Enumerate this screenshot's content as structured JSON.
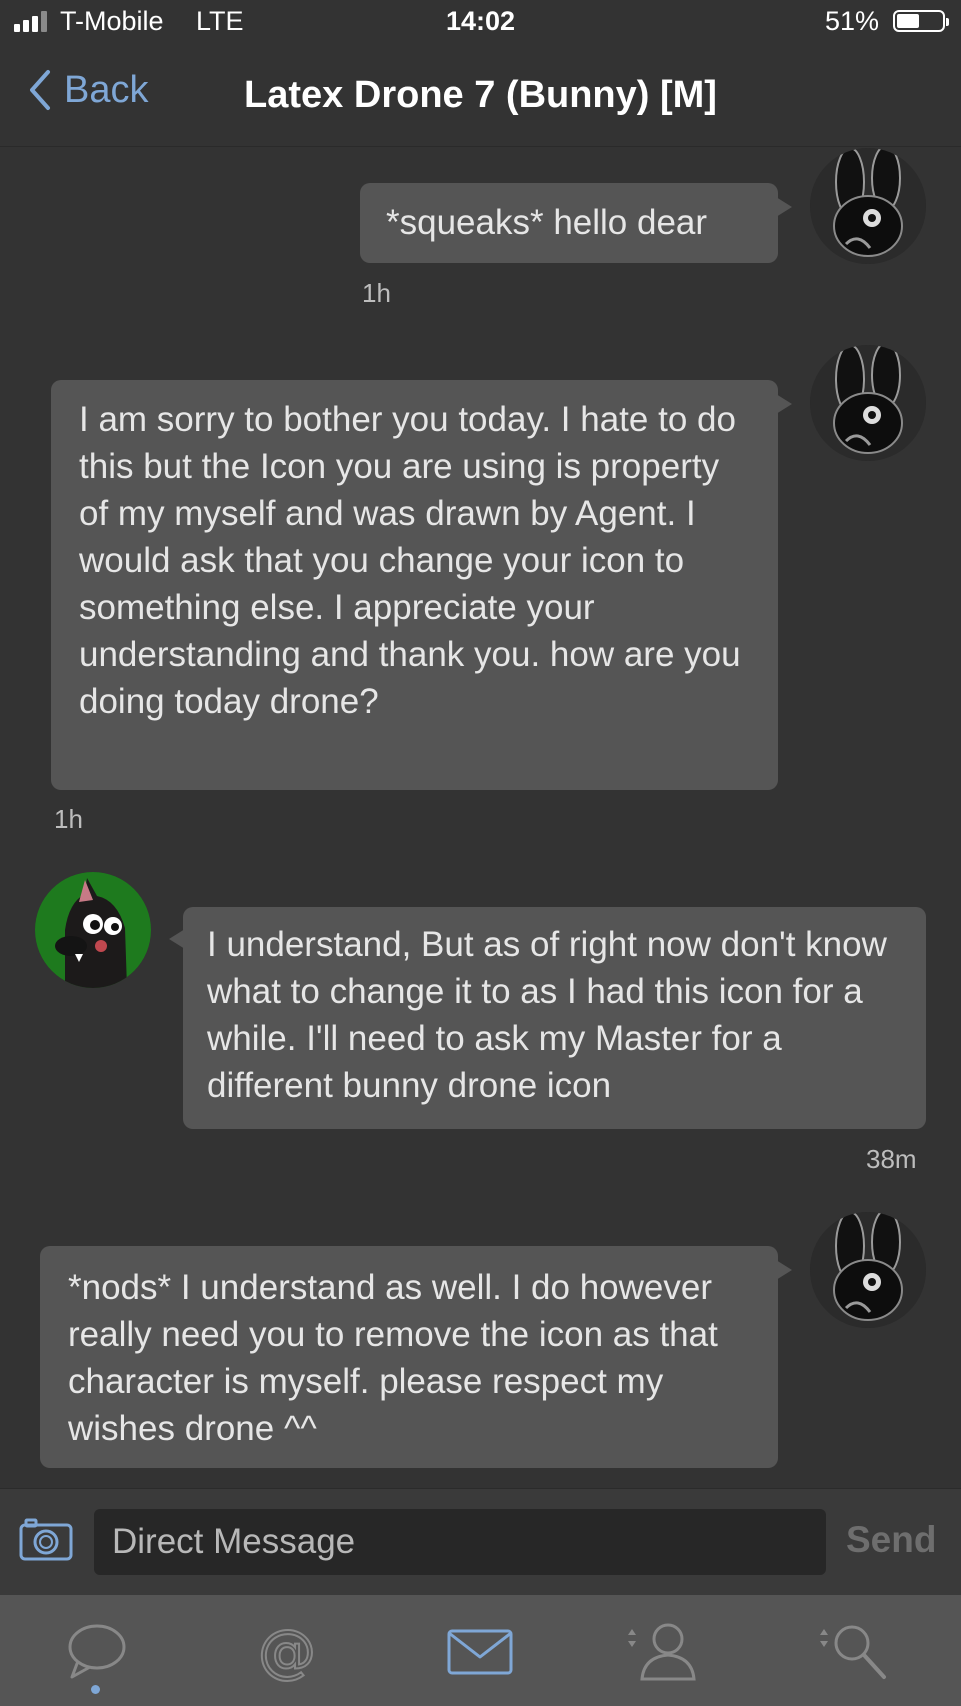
{
  "status_bar": {
    "carrier": "T-Mobile",
    "network": "LTE",
    "time": "14:02",
    "battery_percent_text": "51%",
    "battery_level": 0.51,
    "signal_bars_active": 3,
    "signal_bars_total": 4
  },
  "nav": {
    "back_label": "Back",
    "title": "Latex Drone 7 (Bunny) [M]"
  },
  "messages": [
    {
      "sender": "Latex Drone 7 (Bunny) [M]",
      "avatar": "bunny-drone-avatar",
      "text": "*squeaks* hello dear",
      "time": "1h"
    },
    {
      "sender": "Latex Drone 7 (Bunny) [M]",
      "avatar": "bunny-drone-avatar",
      "text": "I am sorry to bother you today. I hate to do this but the Icon you are using is property of my myself and was drawn by Agent. I would ask that you change your icon to something else. I appreciate your understanding and thank you. how are you doing today drone?",
      "time": "1h"
    },
    {
      "sender": "me",
      "avatar": "wolf-avatar",
      "text": "I understand, But as of right now don't know what to change it to as I had this icon for a while. I'll need to ask my Master for a different bunny drone icon",
      "time": "38m"
    },
    {
      "sender": "Latex Drone 7 (Bunny) [M]",
      "avatar": "bunny-drone-avatar",
      "text": "*nods* I understand as well. I do however really need you to remove the icon as that character is myself. please respect my wishes drone ^^",
      "time": ""
    }
  ],
  "composer": {
    "placeholder": "Direct Message",
    "send_label": "Send"
  },
  "tab_bar": {
    "tabs": [
      "chat-icon",
      "mention-icon",
      "mail-icon",
      "user-sort-icon",
      "search-sort-icon"
    ],
    "active_tab": "chat-icon"
  },
  "colors": {
    "background": "#333333",
    "bubble": "#555555",
    "accent": "#7fa7d6",
    "tab_bar": "#555555"
  }
}
